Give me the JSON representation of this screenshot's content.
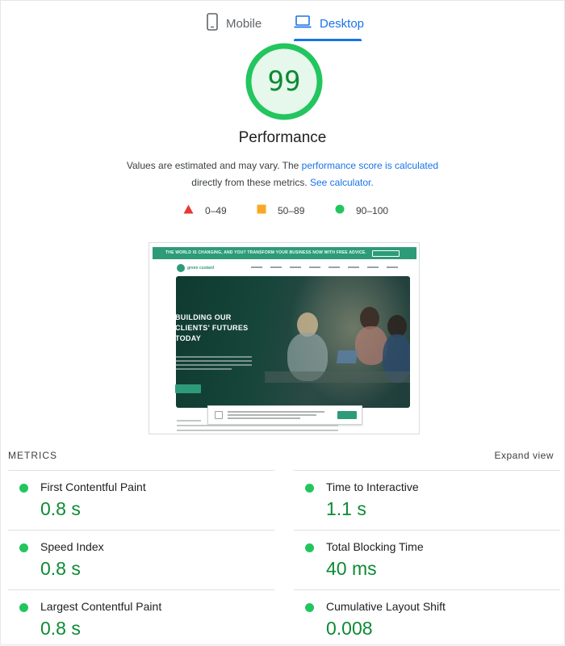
{
  "tabs": {
    "mobile_label": "Mobile",
    "desktop_label": "Desktop"
  },
  "score": {
    "value": "99",
    "fraction": 0.99,
    "title": "Performance",
    "color": "#0c8a34"
  },
  "description": {
    "part1": "Values are estimated and may vary. The ",
    "link1": "performance score is calculated",
    "part2": "directly from these metrics. ",
    "link2": "See calculator."
  },
  "legend": [
    {
      "label": "0–49",
      "color": "#e53935"
    },
    {
      "label": "50–89",
      "color": "#f9a825"
    },
    {
      "label": "90–100",
      "color": "#22c55e"
    }
  ],
  "thumbnail": {
    "banner_text": "THE WORLD IS CHANGING, AND YOU? TRANSFORM YOUR BUSINESS NOW WITH FREE ADVICE.",
    "logo_text": "green custard",
    "hero_title_1": "BUILDING OUR",
    "hero_title_2": "CLIENTS' FUTURES",
    "hero_title_3": "TODAY"
  },
  "metrics": {
    "header": "METRICS",
    "expand_label": "Expand view",
    "items": [
      {
        "label": "First Contentful Paint",
        "value": "0.8 s"
      },
      {
        "label": "Time to Interactive",
        "value": "1.1 s"
      },
      {
        "label": "Speed Index",
        "value": "0.8 s"
      },
      {
        "label": "Total Blocking Time",
        "value": "40 ms"
      },
      {
        "label": "Largest Contentful Paint",
        "value": "0.8 s"
      },
      {
        "label": "Cumulative Layout Shift",
        "value": "0.008"
      }
    ]
  }
}
